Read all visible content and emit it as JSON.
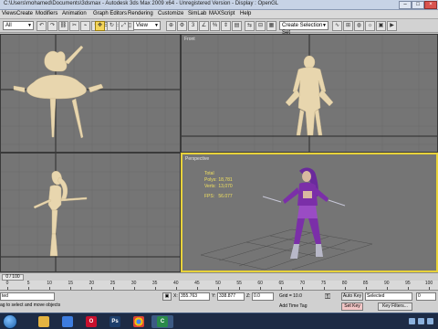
{
  "window": {
    "title": "C:\\Users\\mohamed\\Documents\\3dsmax    -  Autodesk 3ds Max  2009 x64  -  Unregistered Version      - Display : OpenGL"
  },
  "menu": [
    "Views",
    "Create",
    "Modifiers",
    "Animation",
    "Graph Editors",
    "Rendering",
    "Customize",
    "SimLab",
    "MAXScript",
    "Help"
  ],
  "toolbar": {
    "filter_value": "All",
    "view_value": "View",
    "selection_set_value": "Create Selection Set",
    "icons": [
      "undo-icon",
      "redo-icon",
      "link-icon",
      "unlink-icon",
      "bind-icon",
      "select-icon",
      "select-name-icon",
      "region-icon",
      "window-icon",
      "move-icon",
      "rotate-icon",
      "scale-icon",
      "pivot-icon",
      "manipulate-icon",
      "snap-3d-icon",
      "angle-snap-icon",
      "percent-snap-icon",
      "spinner-snap-icon",
      "named-set-icon",
      "mirror-icon",
      "align-icon",
      "layer-icon",
      "curve-editor-icon",
      "schematic-icon",
      "material-editor-icon",
      "render-setup-icon",
      "render-frame-icon",
      "render-icon"
    ]
  },
  "viewports": {
    "front_label": "Front",
    "perspective_label": "Perspective",
    "stats": {
      "heading": "Total",
      "polys_label": "Polys:",
      "polys_value": "18,781",
      "verts_label": "Verts:",
      "verts_value": "13,070",
      "fps_label": "FPS:",
      "fps_value": "56.077"
    }
  },
  "timeline": {
    "slider_text": "0 / 100",
    "ruler_ticks": [
      "0",
      "5",
      "10",
      "15",
      "20",
      "25",
      "30",
      "35",
      "40",
      "45",
      "50",
      "55",
      "60",
      "65",
      "70",
      "75",
      "80",
      "85",
      "90",
      "95",
      "100"
    ]
  },
  "status": {
    "selected_text": "ted",
    "prompt": "ag to select and move objects",
    "x_label": "X:",
    "x_value": "355.763",
    "y_label": "Y:",
    "y_value": "338.877",
    "z_label": "Z:",
    "z_value": "0.0",
    "grid_text": "Grid = 10.0",
    "add_time_tag": "Add Time Tag",
    "auto_key": "Auto Key",
    "set_key": "Set Key",
    "key_mode_value": "Selected",
    "key_filters": "Key Filters...",
    "frame_value": "0"
  },
  "taskbar": {
    "apps": [
      "explorer-icon",
      "media-player-icon",
      "opera-icon",
      "photoshop-icon",
      "chrome-icon",
      "camtasia-icon"
    ],
    "app_letters": [
      "",
      "",
      "O",
      "Ps",
      "",
      "C"
    ]
  },
  "colors": {
    "viewport_bg": "#757575",
    "active_border": "#e8d23a",
    "model_beige": "#e8d6ae",
    "character_purple": "#7b2fa8"
  }
}
